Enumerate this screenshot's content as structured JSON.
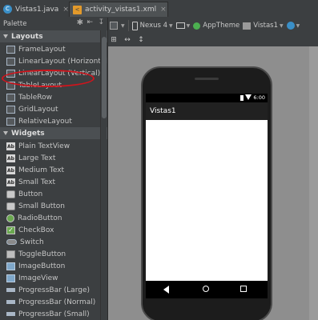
{
  "tabs": [
    {
      "label": "Vistas1.java",
      "icon": "java-class-icon",
      "close": "×"
    },
    {
      "label": "activity_vistas1.xml",
      "icon": "xml-file-icon",
      "close": "×"
    }
  ],
  "palette": {
    "title": "Palette",
    "categories": [
      {
        "name": "Layouts",
        "items": [
          "FrameLayout",
          "LinearLayout (Horizontal)",
          "LinearLayout (Vertical)",
          "TableLayout",
          "TableRow",
          "GridLayout",
          "RelativeLayout"
        ]
      },
      {
        "name": "Widgets",
        "items": [
          "Plain TextView",
          "Large Text",
          "Medium Text",
          "Small Text",
          "Button",
          "Small Button",
          "RadioButton",
          "CheckBox",
          "Switch",
          "ToggleButton",
          "ImageButton",
          "ImageView",
          "ProgressBar (Large)",
          "ProgressBar (Normal)",
          "ProgressBar (Small)"
        ]
      }
    ],
    "highlighted_item": "LinearLayout (Vertical)",
    "highlight_color": "#d0141c"
  },
  "toolbar": {
    "device": "Nexus 4",
    "theme": "AppTheme",
    "activity": "Vistas1"
  },
  "preview": {
    "status_time": "6:00",
    "app_title": "Vistas1"
  }
}
